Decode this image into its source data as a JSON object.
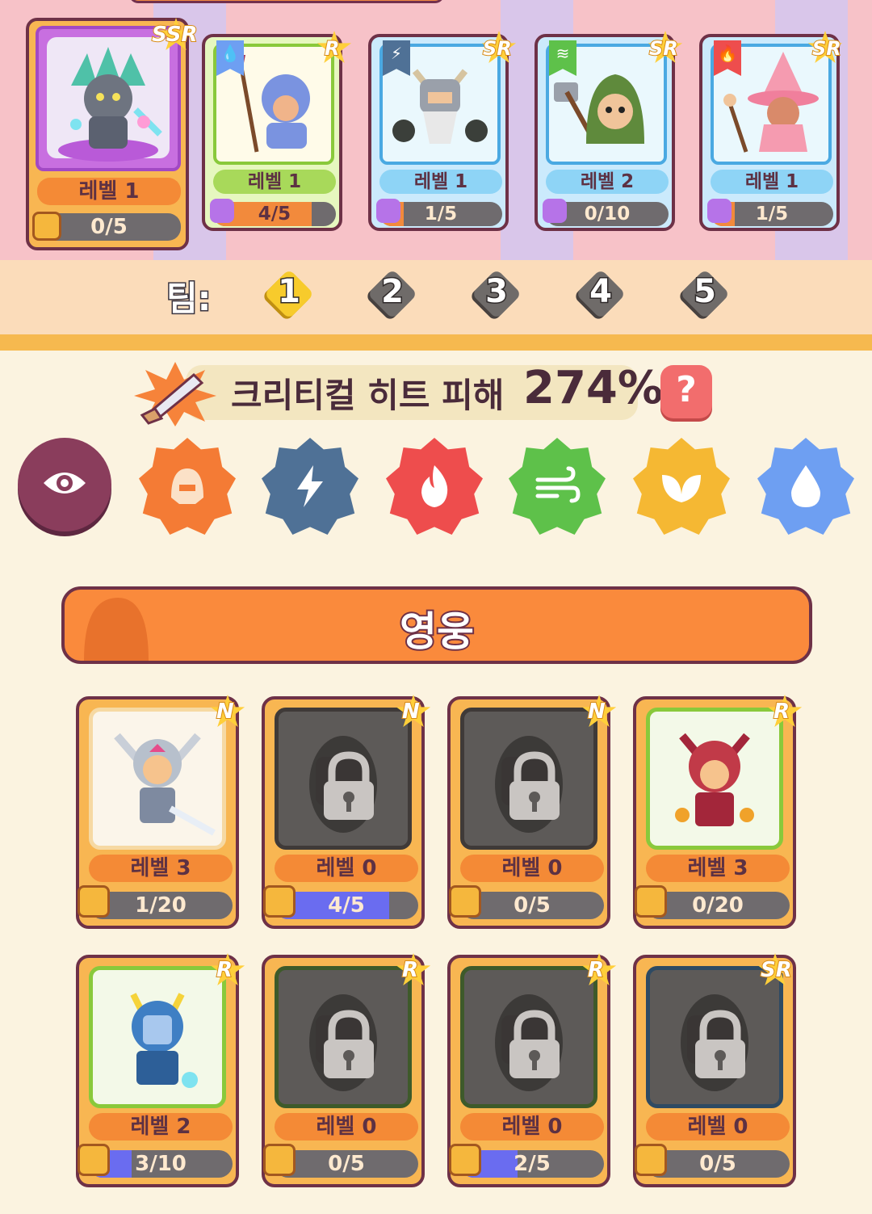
{
  "team": {
    "label": "팀:",
    "slots": [
      "1",
      "2",
      "3",
      "4",
      "5"
    ],
    "active_slot": "1",
    "cards": [
      {
        "rarity": "SSR",
        "level": "레벨 1",
        "progress": "0/5",
        "fill": 0.0
      },
      {
        "rarity": "R",
        "element_icon": "water-drop-icon",
        "level": "레벨 1",
        "progress": "4/5",
        "fill": 0.8
      },
      {
        "rarity": "SR",
        "element_icon": "lightning-icon",
        "level": "레벨 1",
        "progress": "1/5",
        "fill": 0.2
      },
      {
        "rarity": "SR",
        "element_icon": "wind-icon",
        "level": "레벨 2",
        "progress": "0/10",
        "fill": 0.0
      },
      {
        "rarity": "SR",
        "element_icon": "fire-icon",
        "level": "레벨 1",
        "progress": "1/5",
        "fill": 0.2
      }
    ]
  },
  "crit": {
    "label": "크리티컬 히트 피해",
    "value": "274%",
    "help": "?"
  },
  "filters": [
    {
      "name": "eye-icon",
      "color": "#8a3d5c"
    },
    {
      "name": "helmet-icon",
      "color": "#f47b35"
    },
    {
      "name": "lightning-icon",
      "color": "#4f7196"
    },
    {
      "name": "fire-icon",
      "color": "#ee4d4d"
    },
    {
      "name": "wind-icon",
      "color": "#5ec14a"
    },
    {
      "name": "leaf-icon",
      "color": "#f5b833"
    },
    {
      "name": "water-drop-icon",
      "color": "#6e9ff2"
    }
  ],
  "section_title": "영웅",
  "heroes": [
    {
      "rarity": "N",
      "level": "레벨 3",
      "progress": "1/20",
      "fill": 0.05,
      "locked": false
    },
    {
      "rarity": "N",
      "level": "레벨 0",
      "progress": "4/5",
      "fill": 0.8,
      "locked": true
    },
    {
      "rarity": "N",
      "level": "레벨 0",
      "progress": "0/5",
      "fill": 0.0,
      "locked": true
    },
    {
      "rarity": "R",
      "level": "레벨 3",
      "progress": "0/20",
      "fill": 0.0,
      "locked": false
    },
    {
      "rarity": "R",
      "level": "레벨 2",
      "progress": "3/10",
      "fill": 0.3,
      "locked": false
    },
    {
      "rarity": "R",
      "level": "레벨 0",
      "progress": "0/5",
      "fill": 0.0,
      "locked": true
    },
    {
      "rarity": "R",
      "level": "레벨 0",
      "progress": "2/5",
      "fill": 0.4,
      "locked": true
    },
    {
      "rarity": "SR",
      "level": "레벨 0",
      "progress": "0/5",
      "fill": 0.0,
      "locked": true
    }
  ],
  "colors": {
    "accent": "#fa8a3c",
    "progress_fill": "#6a6cf0",
    "outline": "#6e3147"
  }
}
